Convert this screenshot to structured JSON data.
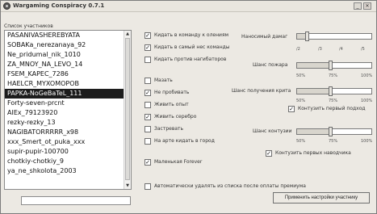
{
  "window": {
    "title": "Wargaming Conspiracy 0.7.1"
  },
  "players": {
    "label": "Список участников",
    "items": [
      "PASANIVASHEREBYATA",
      "SOBAKa_nerezanaya_92",
      "Ne_pridumal_nik_1010",
      "ZA_MNOY_NA_LEVO_14",
      "FSEM_KAPEC_7286",
      "HAELCR_MYXOMOPOB",
      "PAPKA-NoGeBaTeL_111",
      "Forty-seven-prcnt",
      "AIEx_79123920",
      "rezky-rezky_13",
      "NAGIBATORRRRR_x98",
      "xxx_Smert_ot_puka_xxx",
      "supir-pupir-100700",
      "chotkiy-chotkiy_9",
      "ya_ne_shkolota_2003"
    ],
    "selected_index": 6
  },
  "bottom_input": {
    "value": ""
  },
  "options": [
    {
      "label": "Кидать в команду к олениям",
      "checked": true
    },
    {
      "label": "Кидать в самый нес команды",
      "checked": true
    },
    {
      "label": "Кидать против нагибаторов",
      "checked": false
    },
    {
      "label": "Мазать",
      "checked": false
    },
    {
      "label": "Не пробивать",
      "checked": true
    },
    {
      "label": "Живить опыт",
      "checked": false
    },
    {
      "label": "Живить серебро",
      "checked": true
    },
    {
      "label": "Застревать",
      "checked": false
    },
    {
      "label": "На арте кидать в город",
      "checked": false
    },
    {
      "label": "Маленькая Forever",
      "checked": true
    },
    {
      "label": "Автоматически удалять из списка после оплаты премиума",
      "checked": false
    }
  ],
  "damage": {
    "label": "Наносимый дамаг",
    "level": 0.12,
    "ticks": [
      "/2",
      "/3",
      "/4",
      "/5"
    ]
  },
  "fire": {
    "label": "Шанс пожара",
    "level": 0.45,
    "ticks": [
      "50%",
      "75%",
      "100%"
    ]
  },
  "crit": {
    "label": "Шанс получения крита",
    "level": 0.45,
    "ticks": [
      "50%",
      "75%",
      "100%"
    ],
    "extra_label": "Контузить первый подход",
    "extra_checked": true
  },
  "concussion": {
    "label": "Шанс контузии",
    "level": 0.45,
    "ticks": [
      "50%",
      "75%",
      "100%"
    ],
    "extra_label": "Контузить первых наводчика",
    "extra_checked": true
  },
  "apply_label": "Применить настройки участнику"
}
